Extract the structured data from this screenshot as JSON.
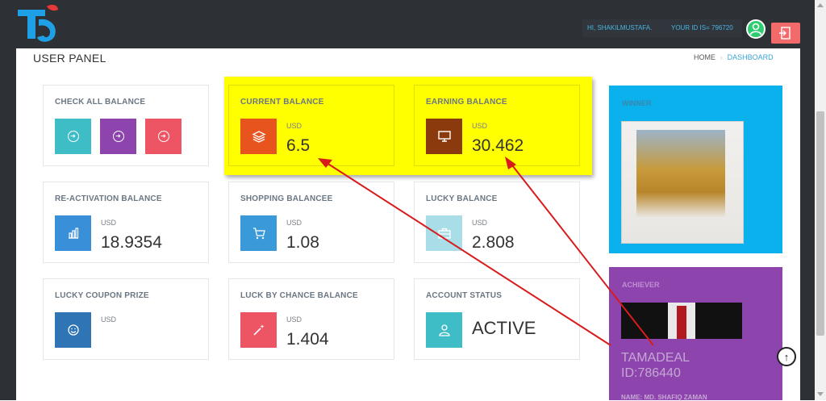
{
  "header": {
    "greeting": "HI, SHAKILMUSTAFA.",
    "user_id": "YOUR ID IS= 796720"
  },
  "page": {
    "title": "USER PANEL",
    "breadcrumb": [
      "HOME",
      "DASHBOARD"
    ]
  },
  "cards": [
    {
      "title": "CHECK ALL BALANCE",
      "buttons": [
        "#3ebdc6",
        "#8e44ad",
        "#ed5565"
      ]
    },
    {
      "title": "CURRENT BALANCE",
      "currency": "USD",
      "value": "6.5",
      "icon": "layers-icon",
      "color": "#e8541d",
      "highlighted": true
    },
    {
      "title": "EARNING BALANCE",
      "currency": "USD",
      "value": "30.462",
      "icon": "monitor-icon",
      "color": "#8b3a0e",
      "highlighted": true
    },
    {
      "title": "RE-ACTIVATION BALANCE",
      "currency": "USD",
      "value": "18.9354",
      "icon": "bar-chart-icon",
      "color": "#3a8fd9"
    },
    {
      "title": "SHOPPING BALANCEE",
      "currency": "USD",
      "value": "1.08",
      "icon": "cart-icon",
      "color": "#3a9ad9"
    },
    {
      "title": "LUCKY BALANCE",
      "currency": "USD",
      "value": "2.808",
      "icon": "briefcase-icon",
      "color": "#a9dde8"
    },
    {
      "title": "LUCKY COUPON PRIZE",
      "currency": "USD",
      "value": "",
      "icon": "smile-icon",
      "color": "#2f74b5"
    },
    {
      "title": "LUCK BY CHANCE BALANCE",
      "currency": "USD",
      "value": "1.404",
      "icon": "magic-wand-icon",
      "color": "#ed5565"
    },
    {
      "title": "ACCOUNT STATUS",
      "value": "ACTIVE",
      "icon": "user-icon",
      "color": "#3ebdc6"
    }
  ],
  "winner": {
    "label": "WINNER"
  },
  "achiever": {
    "label": "ACHIEVER",
    "name_line1": "TAMADEAL",
    "name_line2": "ID:786440",
    "note": "NAME: MD. SHAFIQ ZAMAN"
  },
  "colors": {
    "topbar": "#2d3035",
    "highlight": "#ffff00",
    "annotation_arrow": "#d81b1b",
    "winner_bg": "#0ab1ec",
    "achiever_bg": "#8e44ad"
  }
}
